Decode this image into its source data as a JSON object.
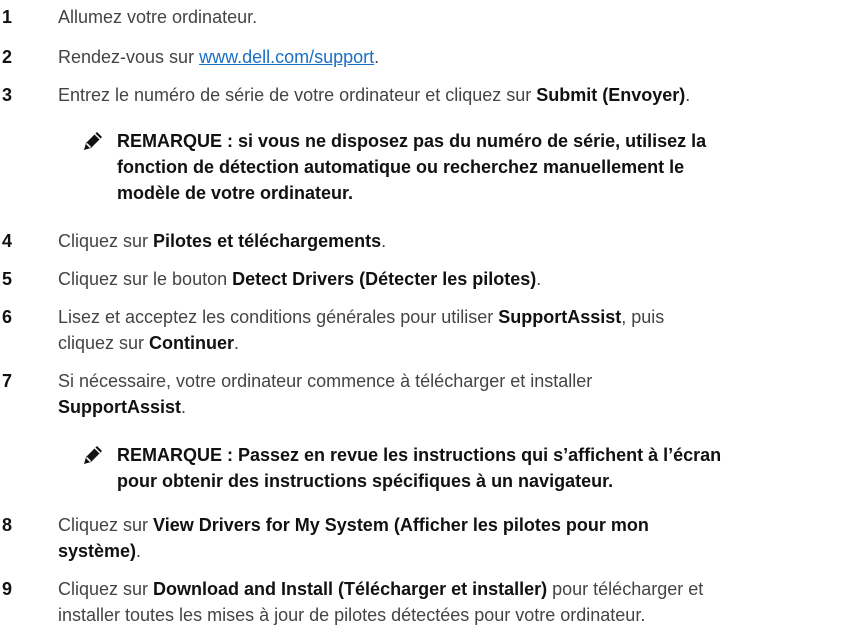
{
  "steps": [
    {
      "num": "1",
      "text": "Allumez votre ordinateur."
    },
    {
      "num": "2",
      "pre": "Rendez-vous sur ",
      "link": "www.dell.com/support",
      "post": "."
    },
    {
      "num": "3",
      "pre": "Entrez le numéro de série de votre ordinateur et cliquez sur ",
      "bold": "Submit (Envoyer)",
      "post": "."
    },
    {
      "num": "4",
      "pre": "Cliquez sur ",
      "bold": "Pilotes et téléchargements",
      "post": "."
    },
    {
      "num": "5",
      "pre": "Cliquez sur le bouton ",
      "bold": "Detect Drivers (Détecter les pilotes)",
      "post": "."
    },
    {
      "num": "6",
      "pre": "Lisez et acceptez les conditions générales pour utiliser ",
      "bold": "SupportAssist",
      "post": ", puis",
      "line2_pre": "cliquez sur ",
      "line2_bold": "Continuer",
      "line2_post": "."
    },
    {
      "num": "7",
      "pre": "Si nécessaire, votre ordinateur commence à télécharger et installer",
      "line2_bold": "SupportAssist",
      "line2_post": "."
    },
    {
      "num": "8",
      "pre": "Cliquez sur ",
      "bold": "View Drivers for My System (Afficher les pilotes pour mon",
      "line2_bold": "système)",
      "line2_post": "."
    },
    {
      "num": "9",
      "pre": "Cliquez sur ",
      "bold": "Download and Install (Télécharger et installer)",
      "post": " pour télécharger et",
      "line2_pre": "installer toutes les mises à jour de pilotes détectées pour votre ordinateur."
    }
  ],
  "notes": [
    {
      "icon": "pencil-note-icon",
      "line1": "REMARQUE : si vous ne disposez pas du numéro de série, utilisez la",
      "line2": "fonction de détection automatique ou recherchez manuellement le",
      "line3": "modèle de votre ordinateur."
    },
    {
      "icon": "pencil-note-icon",
      "line1": "REMARQUE : Passez en revue les instructions qui s’affichent à l’écran",
      "line2": "pour obtenir des instructions spécifiques à un navigateur."
    }
  ]
}
